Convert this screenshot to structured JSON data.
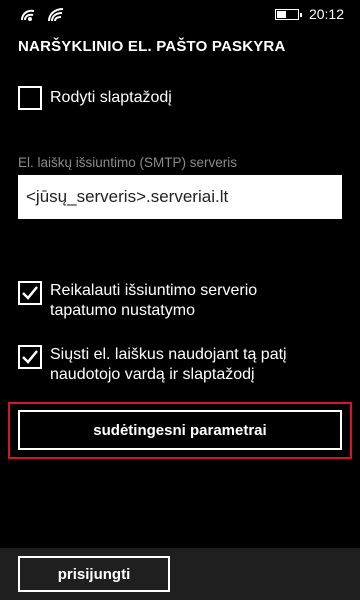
{
  "status_bar": {
    "time": "20:12",
    "battery_level": 0.45,
    "icons": [
      "data-sync-icon",
      "wifi-icon",
      "battery-icon"
    ]
  },
  "page": {
    "title": "NARŠYKLINIO EL. PAŠTO PASKYRA"
  },
  "show_password": {
    "label": "Rodyti slaptažodį",
    "checked": false
  },
  "smtp": {
    "label": "El. laiškų išsiuntimo (SMTP) serveris",
    "value": "<jūsų_serveris>.serveriai.lt"
  },
  "require_auth": {
    "label_line1": "Reikalauti išsiuntimo serverio",
    "label_line2": "tapatumo nustatymo",
    "checked": true
  },
  "same_credentials": {
    "label_line1": "Siųsti el. laiškus naudojant tą patį",
    "label_line2": "naudotojo vardą ir slaptažodį",
    "checked": true
  },
  "advanced": {
    "label": "sudėtingesni parametrai",
    "highlight_color": "#d3142a"
  },
  "app_bar": {
    "login_label": "prisijungti"
  }
}
